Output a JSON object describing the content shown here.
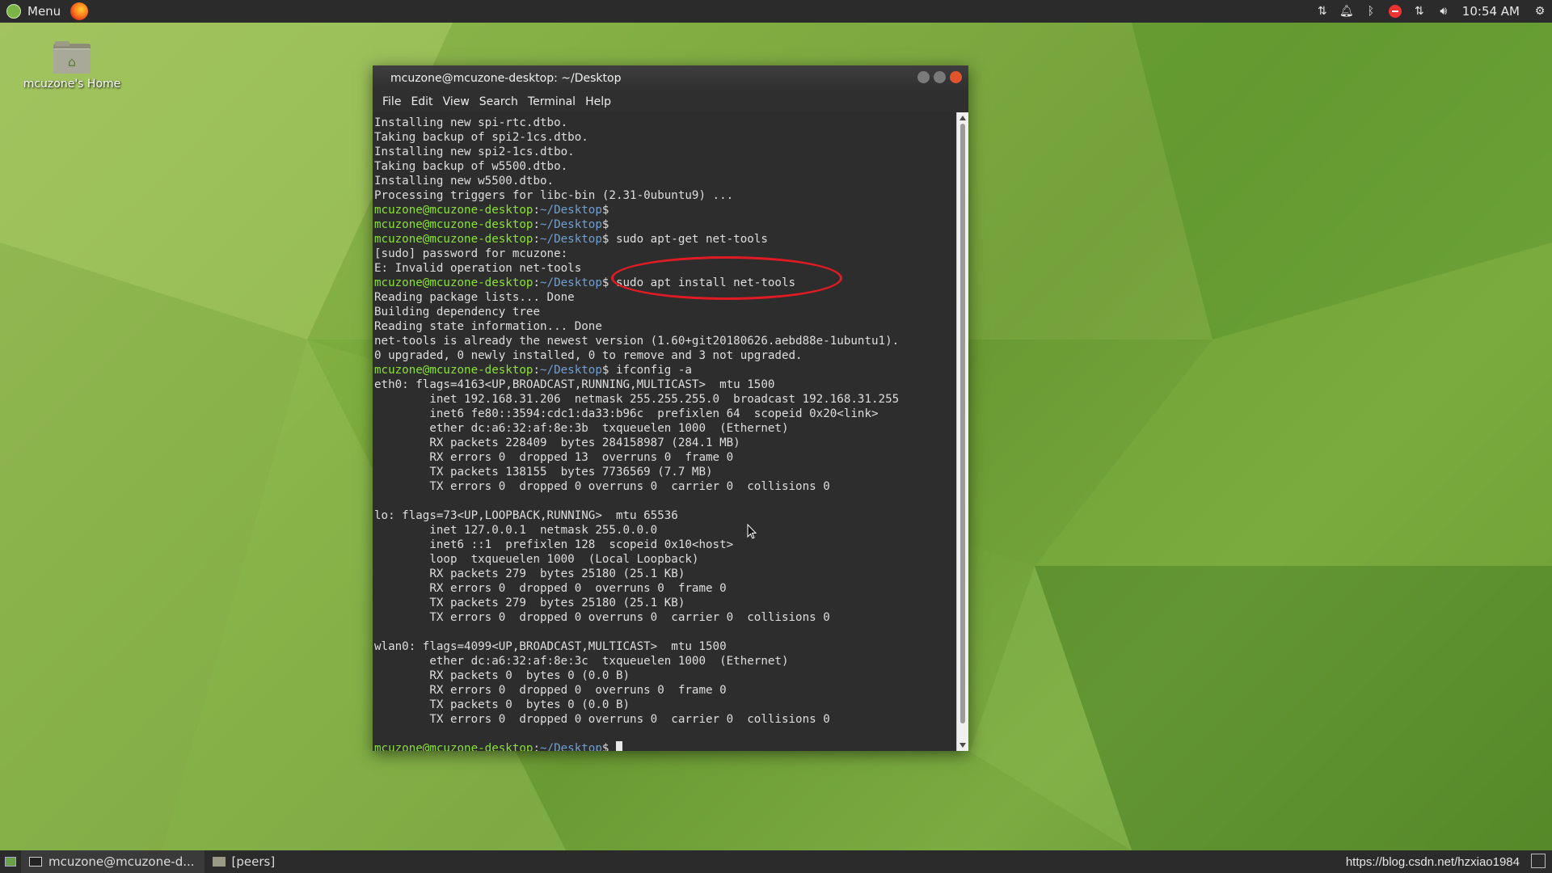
{
  "top_panel": {
    "menu_label": "Menu",
    "clock": "10:54 AM",
    "tray_icons": [
      "network-transfer-icon",
      "notification-bell-icon",
      "bluetooth-icon",
      "do-not-disturb-icon",
      "network-icon",
      "volume-icon",
      "settings-gear-icon"
    ]
  },
  "desktop": {
    "home_icon_label": "mcuzone's Home"
  },
  "terminal": {
    "title": "mcuzone@mcuzone-desktop: ~/Desktop",
    "menu": [
      "File",
      "Edit",
      "View",
      "Search",
      "Terminal",
      "Help"
    ],
    "prompt_user": "mcuzone@mcuzone-desktop",
    "prompt_path": "~/Desktop",
    "lines": [
      {
        "t": "Installing new spi-rtc.dtbo."
      },
      {
        "t": "Taking backup of spi2-1cs.dtbo."
      },
      {
        "t": "Installing new spi2-1cs.dtbo."
      },
      {
        "t": "Taking backup of w5500.dtbo."
      },
      {
        "t": "Installing new w5500.dtbo."
      },
      {
        "t": "Processing triggers for libc-bin (2.31-0ubuntu9) ..."
      },
      {
        "p": ""
      },
      {
        "p": ""
      },
      {
        "p": " sudo apt-get net-tools"
      },
      {
        "t": "[sudo] password for mcuzone:"
      },
      {
        "t": "E: Invalid operation net-tools"
      },
      {
        "p": " sudo apt install net-tools"
      },
      {
        "t": "Reading package lists... Done"
      },
      {
        "t": "Building dependency tree"
      },
      {
        "t": "Reading state information... Done"
      },
      {
        "t": "net-tools is already the newest version (1.60+git20180626.aebd88e-1ubuntu1)."
      },
      {
        "t": "0 upgraded, 0 newly installed, 0 to remove and 3 not upgraded."
      },
      {
        "p": " ifconfig -a"
      },
      {
        "t": "eth0: flags=4163<UP,BROADCAST,RUNNING,MULTICAST>  mtu 1500"
      },
      {
        "t": "        inet 192.168.31.206  netmask 255.255.255.0  broadcast 192.168.31.255"
      },
      {
        "t": "        inet6 fe80::3594:cdc1:da33:b96c  prefixlen 64  scopeid 0x20<link>"
      },
      {
        "t": "        ether dc:a6:32:af:8e:3b  txqueuelen 1000  (Ethernet)"
      },
      {
        "t": "        RX packets 228409  bytes 284158987 (284.1 MB)"
      },
      {
        "t": "        RX errors 0  dropped 13  overruns 0  frame 0"
      },
      {
        "t": "        TX packets 138155  bytes 7736569 (7.7 MB)"
      },
      {
        "t": "        TX errors 0  dropped 0 overruns 0  carrier 0  collisions 0"
      },
      {
        "t": ""
      },
      {
        "t": "lo: flags=73<UP,LOOPBACK,RUNNING>  mtu 65536"
      },
      {
        "t": "        inet 127.0.0.1  netmask 255.0.0.0"
      },
      {
        "t": "        inet6 ::1  prefixlen 128  scopeid 0x10<host>"
      },
      {
        "t": "        loop  txqueuelen 1000  (Local Loopback)"
      },
      {
        "t": "        RX packets 279  bytes 25180 (25.1 KB)"
      },
      {
        "t": "        RX errors 0  dropped 0  overruns 0  frame 0"
      },
      {
        "t": "        TX packets 279  bytes 25180 (25.1 KB)"
      },
      {
        "t": "        TX errors 0  dropped 0 overruns 0  carrier 0  collisions 0"
      },
      {
        "t": ""
      },
      {
        "t": "wlan0: flags=4099<UP,BROADCAST,MULTICAST>  mtu 1500"
      },
      {
        "t": "        ether dc:a6:32:af:8e:3c  txqueuelen 1000  (Ethernet)"
      },
      {
        "t": "        RX packets 0  bytes 0 (0.0 B)"
      },
      {
        "t": "        RX errors 0  dropped 0  overruns 0  frame 0"
      },
      {
        "t": "        TX packets 0  bytes 0 (0.0 B)"
      },
      {
        "t": "        TX errors 0  dropped 0 overruns 0  carrier 0  collisions 0"
      },
      {
        "t": ""
      },
      {
        "p": " ",
        "cursor": true
      }
    ]
  },
  "taskbar": {
    "items": [
      {
        "label": "mcuzone@mcuzone-d...",
        "icon": "terminal-icon",
        "active": true
      },
      {
        "label": "[peers]",
        "icon": "folder-icon",
        "active": false
      }
    ],
    "watermark": "https://blog.csdn.net/hzxiao1984"
  },
  "colors": {
    "prompt_user": "#8ae234",
    "prompt_path": "#729fcf",
    "annotation": "#e01b24"
  }
}
